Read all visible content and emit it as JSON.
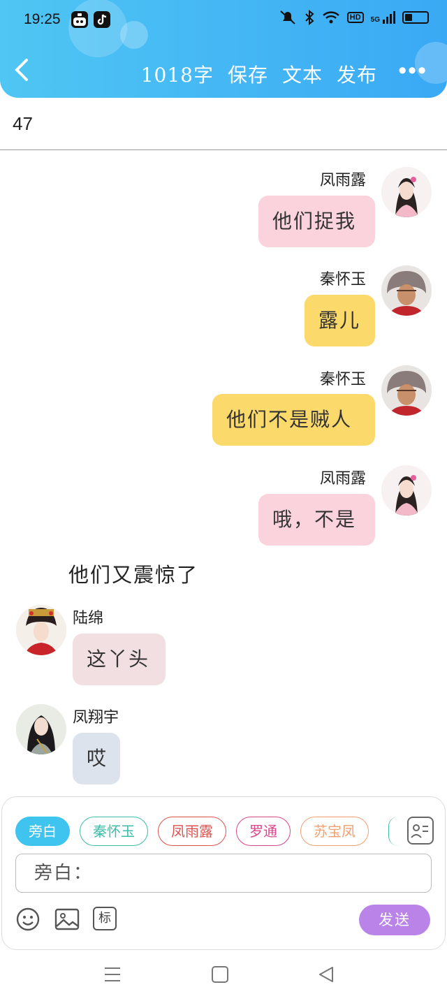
{
  "status_bar": {
    "time": "19:25",
    "icons": [
      "notifications-app-icon",
      "tiktok-icon",
      "mute-icon",
      "bluetooth-icon",
      "wifi-icon",
      "hd-icon",
      "5g-signal-icon",
      "battery-icon"
    ],
    "hd_label": "HD",
    "signal_label": "5G"
  },
  "header": {
    "back_icon": "chevron-left-icon",
    "word_count": "1018字",
    "save_label": "保存",
    "text_label": "文本",
    "publish_label": "发布",
    "more_icon": "more-dots-icon",
    "more_glyph": "•••"
  },
  "chapter_number": "47",
  "messages": [
    {
      "speaker": "凤雨露",
      "text": "他们捉我",
      "side": "right",
      "color": "#fbd3dd",
      "avatar": "avatar-feng-yulu"
    },
    {
      "speaker": "秦怀玉",
      "text": "露儿",
      "side": "right",
      "color": "#fcd96b",
      "avatar": "avatar-qin-huaiyu"
    },
    {
      "speaker": "秦怀玉",
      "text": "他们不是贼人",
      "side": "right",
      "color": "#fcd96b",
      "avatar": "avatar-qin-huaiyu"
    },
    {
      "speaker": "凤雨露",
      "text": "哦，不是",
      "side": "right",
      "color": "#fbd3dd",
      "avatar": "avatar-feng-yulu"
    },
    {
      "narration": "他们又震惊了"
    },
    {
      "speaker": "陆绵",
      "text": "这丫头",
      "side": "left",
      "color": "#f2dfe1",
      "avatar": "avatar-lu-mian"
    },
    {
      "speaker": "凤翔宇",
      "text": "哎",
      "side": "left",
      "color": "#dde3ec",
      "avatar": "avatar-feng-xiangyu"
    }
  ],
  "role_chips": [
    {
      "label": "旁白",
      "active": true,
      "color": "#3fc4ef"
    },
    {
      "label": "秦怀玉",
      "active": false,
      "color": "#3cbcaa"
    },
    {
      "label": "凤雨露",
      "active": false,
      "color": "#d9534f"
    },
    {
      "label": "罗通",
      "active": false,
      "color": "#d9468e"
    },
    {
      "label": "苏宝凤",
      "active": false,
      "color": "#f0a070"
    }
  ],
  "input": {
    "value": "旁白："
  },
  "tools": {
    "emoji_icon": "smiley-icon",
    "image_icon": "image-icon",
    "tag_label": "标",
    "send_label": "发送"
  },
  "nav": {
    "menu_icon": "menu-icon",
    "home_icon": "home-square-icon",
    "back_icon": "back-triangle-icon"
  }
}
